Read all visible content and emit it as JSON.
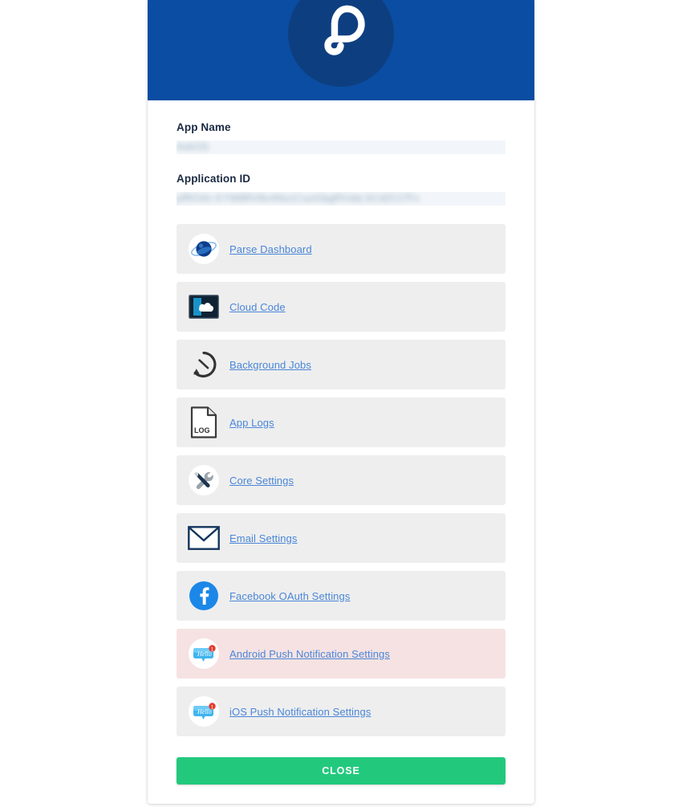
{
  "header": {
    "logo_icon": "parse-logo-icon",
    "background_color": "#0a4da2",
    "logo_circle_color": "#0d3f80"
  },
  "fields": [
    {
      "label": "App Name",
      "value": "AskOS",
      "redacted": true
    },
    {
      "label": "Application ID",
      "value": "pfRO4n KYW8RV8v4No1CuoGbgRVsbLSCdZCt7Fv",
      "redacted": true
    }
  ],
  "links": [
    {
      "label": "Parse Dashboard",
      "icon": "parse-sphere-icon",
      "highlighted": false
    },
    {
      "label": "Cloud Code",
      "icon": "cloud-code-icon",
      "highlighted": false
    },
    {
      "label": "Background Jobs",
      "icon": "background-jobs-clock-icon",
      "highlighted": false
    },
    {
      "label": "App Logs",
      "icon": "log-document-icon",
      "highlighted": false
    },
    {
      "label": "Core Settings",
      "icon": "tools-icon",
      "highlighted": false
    },
    {
      "label": "Email Settings",
      "icon": "envelope-icon",
      "highlighted": false
    },
    {
      "label": "Facebook OAuth Settings",
      "icon": "facebook-icon",
      "highlighted": false
    },
    {
      "label": "Android Push Notification Settings",
      "icon": "push-notification-icon",
      "highlighted": true
    },
    {
      "label": "iOS Push Notification Settings",
      "icon": "push-notification-icon",
      "highlighted": false
    }
  ],
  "footer": {
    "close_label": "CLOSE",
    "close_color": "#22c97d"
  },
  "colors": {
    "link": "#4a86d8",
    "row_background": "#eeeeee",
    "row_highlight_background": "#f6e2e2",
    "label_text": "#1b2a43"
  }
}
